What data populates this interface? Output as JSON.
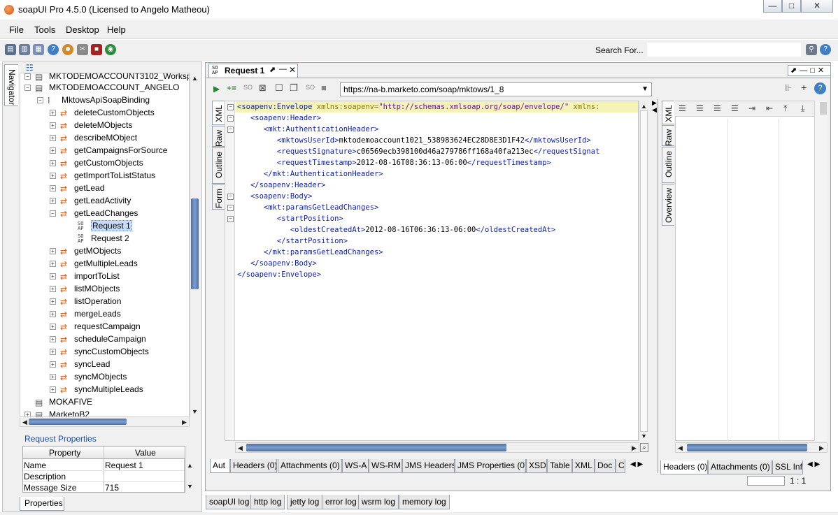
{
  "window": {
    "title": "soapUI Pro 4.5.0 (Licensed to Angelo Matheou)",
    "controls": [
      "—",
      "□",
      "✕"
    ]
  },
  "menu": [
    "File",
    "Tools",
    "Desktop",
    "Help"
  ],
  "search": {
    "label": "Search For...",
    "value": ""
  },
  "navigator": {
    "tab_label": "Navigator",
    "items": [
      {
        "label": "MKTODEMOACCOUNT3102_Workspa"
      },
      {
        "label": "MKTODEMOACCOUNT_ANGELO"
      },
      {
        "label": "MktowsApiSoapBinding"
      },
      {
        "label": "deleteCustomObjects"
      },
      {
        "label": "deleteMObjects"
      },
      {
        "label": "describeMObject"
      },
      {
        "label": "getCampaignsForSource"
      },
      {
        "label": "getCustomObjects"
      },
      {
        "label": "getImportToListStatus"
      },
      {
        "label": "getLead"
      },
      {
        "label": "getLeadActivity"
      },
      {
        "label": "getLeadChanges"
      },
      {
        "label": "Request 1"
      },
      {
        "label": "Request 2"
      },
      {
        "label": "getMObjects"
      },
      {
        "label": "getMultipleLeads"
      },
      {
        "label": "importToList"
      },
      {
        "label": "listMObjects"
      },
      {
        "label": "listOperation"
      },
      {
        "label": "mergeLeads"
      },
      {
        "label": "requestCampaign"
      },
      {
        "label": "scheduleCampaign"
      },
      {
        "label": "syncCustomObjects"
      },
      {
        "label": "syncLead"
      },
      {
        "label": "syncMObjects"
      },
      {
        "label": "syncMultipleLeads"
      },
      {
        "label": "MOKAFIVE"
      },
      {
        "label": "MarketoB2"
      }
    ]
  },
  "request_properties": {
    "title": "Request Properties",
    "header_property": "Property",
    "header_value": "Value",
    "rows": [
      {
        "name": "Name",
        "value": "Request 1"
      },
      {
        "name": "Description",
        "value": ""
      },
      {
        "name": "Message Size",
        "value": "715"
      }
    ],
    "tab": "Properties"
  },
  "request": {
    "tab_title": "Request 1",
    "url": "https://na-b.marketo.com/soap/mktows/1_8",
    "side_tabs": [
      "XML",
      "Raw",
      "Outline",
      "Form"
    ],
    "xml_lines": [
      "<soapenv:Envelope xmlns:soapenv=\"http://schemas.xmlsoap.org/soap/envelope/\" xmlns:",
      "   <soapenv:Header>",
      "      <mkt:AuthenticationHeader>",
      "         <mktowsUserId>mktodemoaccount1021_538983624EC28D8E3D1F42</mktowsUserId>",
      "         <requestSignature>c06569ecb398100d46a279786ff168a40fa213ec</requestSignat",
      "         <requestTimestamp>2012-08-16T08:36:13-06:00</requestTimestamp>",
      "      </mkt:AuthenticationHeader>",
      "   </soapenv:Header>",
      "   <soapenv:Body>",
      "      <mkt:paramsGetLeadChanges>",
      "         <startPosition>",
      "            <oldestCreatedAt>2012-08-16T06:36:13-06:00</oldestCreatedAt>",
      "         </startPosition>",
      "      </mkt:paramsGetLeadChanges>",
      "   </soapenv:Body>",
      "</soapenv:Envelope>"
    ],
    "bottom_tabs": [
      "Aut",
      "Headers (0)",
      "Attachments (0)",
      "WS-A",
      "WS-RM",
      "JMS Headers",
      "JMS Properties (0)",
      "XSD",
      "Table",
      "XML",
      "Doc",
      "C"
    ]
  },
  "response": {
    "side_tabs": [
      "XML",
      "Raw",
      "Outline",
      "Overview"
    ],
    "bottom_tabs": [
      "Headers (0)",
      "Attachments (0)",
      "SSL Inf"
    ],
    "position": "1 : 1"
  },
  "log_tabs": [
    "soapUI log",
    "http log",
    "jetty log",
    "error log",
    "wsrm log",
    "memory log"
  ]
}
